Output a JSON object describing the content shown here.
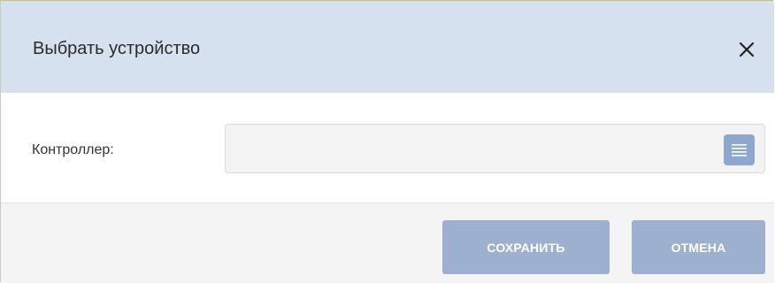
{
  "dialog": {
    "title": "Выбрать устройство",
    "close_icon": "close-icon"
  },
  "form": {
    "controller": {
      "label": "Контроллер:",
      "value": "",
      "placeholder": "",
      "list_button_icon": "list-icon"
    }
  },
  "footer": {
    "save_label": "СОХРАНИТЬ",
    "cancel_label": "ОТМЕНА"
  },
  "colors": {
    "header_bg": "#d6e1ef",
    "button_bg": "#9db0d0",
    "list_button_bg": "#8ea7cf",
    "footer_bg": "#f4f4f4"
  }
}
